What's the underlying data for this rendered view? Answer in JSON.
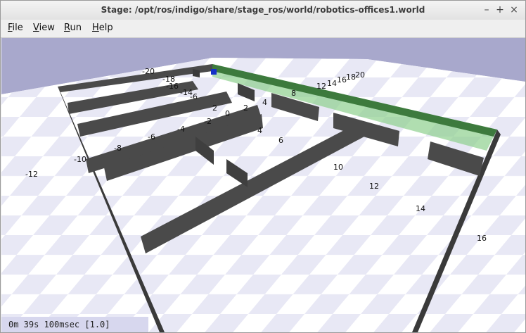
{
  "window": {
    "title": "Stage: /opt/ros/indigo/share/stage_ros/world/robotics-offices1.world"
  },
  "controls": {
    "minimize": "–",
    "maximize": "+",
    "close": "×"
  },
  "menu": [
    {
      "label": "File",
      "u": "F",
      "rest": "ile"
    },
    {
      "label": "View",
      "u": "V",
      "rest": "iew"
    },
    {
      "label": "Run",
      "u": "R",
      "rest": "un"
    },
    {
      "label": "Help",
      "u": "H",
      "rest": "elp"
    }
  ],
  "scene": {
    "labels_left": [
      "-20",
      "-18",
      "-16",
      "-14",
      "-12",
      "-10",
      "-8",
      "-6",
      "-4",
      "-2"
    ],
    "labels_mid": [
      "0",
      "2",
      "4",
      "6",
      "8"
    ],
    "labels_right": [
      "10",
      "12",
      "14",
      "16",
      "18",
      "20"
    ],
    "extra": [
      "-6",
      "-2",
      "2",
      "4",
      "6",
      "8",
      "10",
      "12",
      "14",
      "16"
    ]
  },
  "status": {
    "text": "0m 39s 100msec [1.0]"
  },
  "colors": {
    "sky": "#a8a8cc",
    "wall": "#4a4a4a",
    "wall_top": "#2f2f2f",
    "green": "#3d7a3d",
    "floor_light": "#ffffff",
    "floor_dark": "#e6e6f4"
  }
}
